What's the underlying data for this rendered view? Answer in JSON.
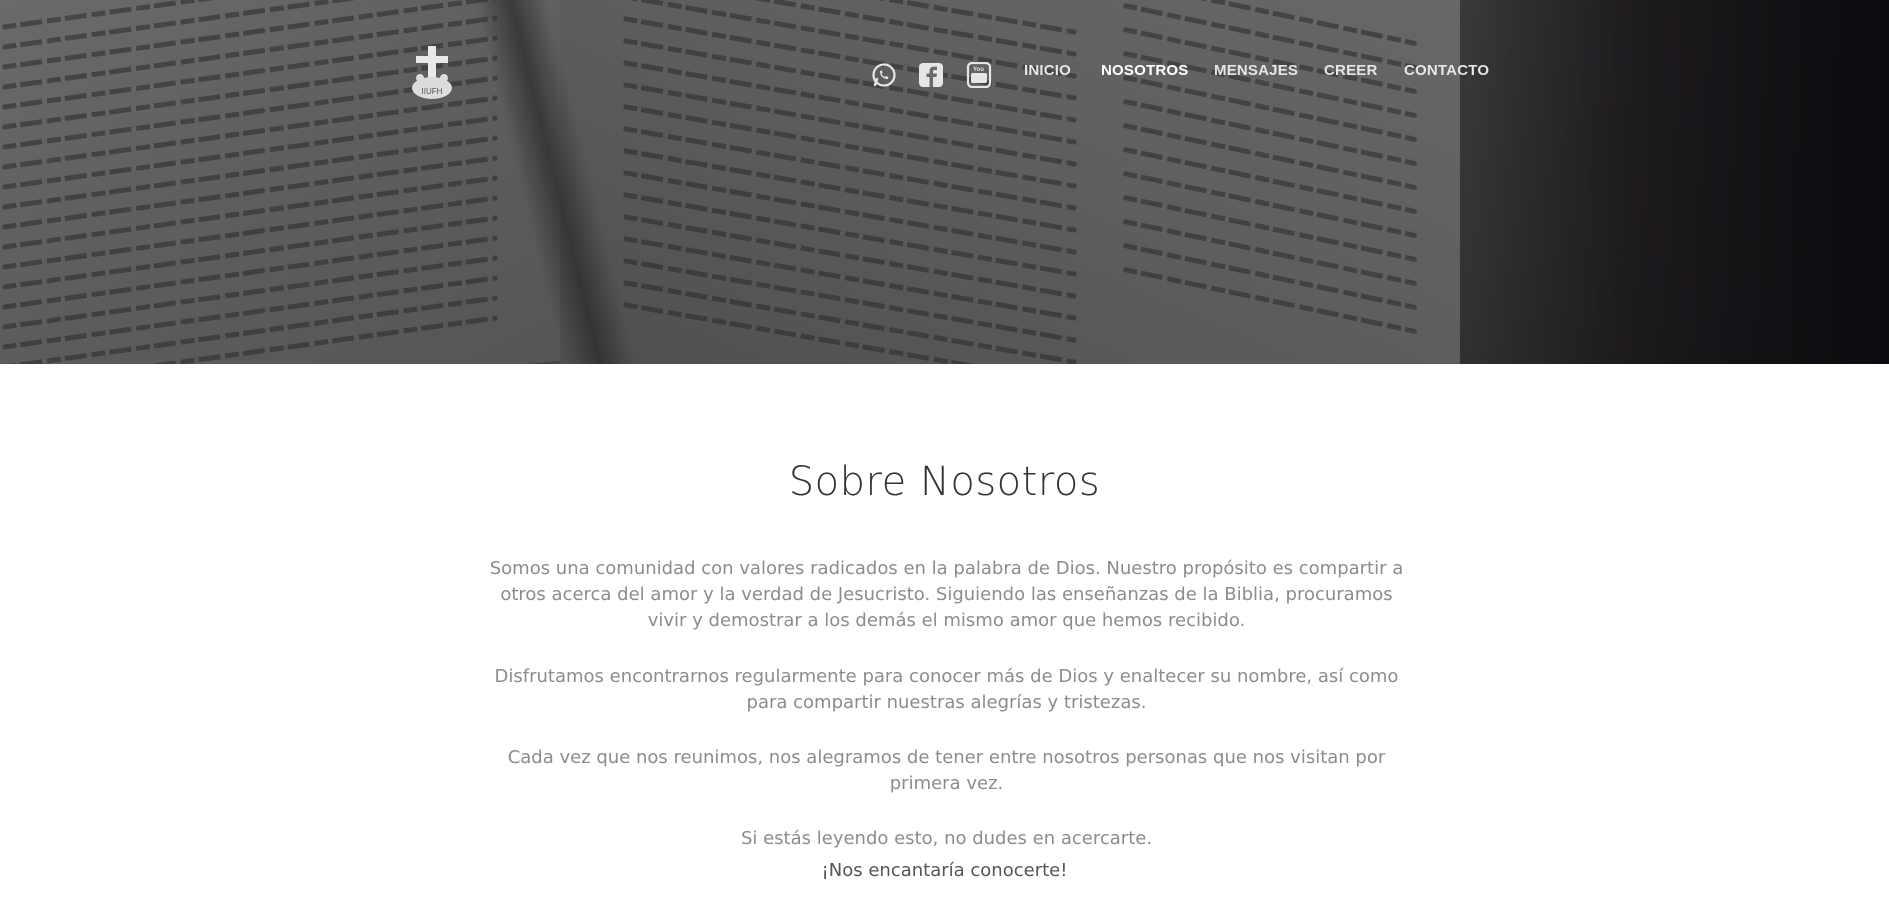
{
  "header": {
    "logo_alt": "church-logo",
    "social": [
      {
        "name": "whatsapp",
        "icon": "whatsapp-icon"
      },
      {
        "name": "facebook",
        "icon": "facebook-icon"
      },
      {
        "name": "youtube",
        "icon": "youtube-icon"
      }
    ],
    "nav": [
      {
        "label": "INICIO",
        "active": false
      },
      {
        "label": "NOSOTROS",
        "active": true
      },
      {
        "label": "MENSAJES",
        "active": false
      },
      {
        "label": "CREER",
        "active": false
      },
      {
        "label": "CONTACTO",
        "active": false
      }
    ]
  },
  "hero": {
    "background": "open-bible-photo"
  },
  "about": {
    "title": "Sobre Nosotros",
    "paragraphs": [
      "Somos una comunidad con valores radicados en la palabra de Dios. Nuestro propósito es compartir a otros acerca del amor y la verdad de Jesucristo. Siguiendo las enseñanzas de la Biblia, procuramos vivir y demostrar a los demás el mismo amor que hemos recibido.",
      "Disfrutamos encontrarnos regularmente para conocer más de Dios y enaltecer su nombre, así como para compartir nuestras alegrías y tristezas.",
      "Cada vez que nos reunimos, nos alegramos de tener entre nosotros personas que nos visitan por primera vez.",
      "Si estás leyendo esto, no dudes en acercarte."
    ],
    "closing": "¡Nos encantaría conocerte!"
  },
  "colors": {
    "nav_text": "#e6e6e6",
    "title": "#333333",
    "body_text": "#8c8c8c"
  }
}
